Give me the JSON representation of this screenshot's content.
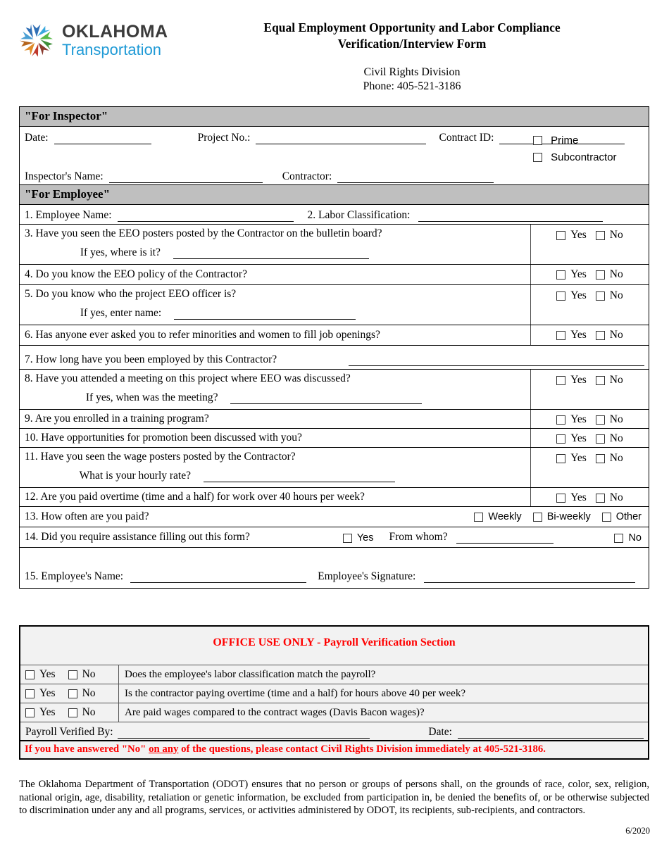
{
  "header": {
    "logo_name_line1": "OKLAHOMA",
    "logo_name_line2": "Transportation",
    "title_line1": "Equal Employment Opportunity and Labor Compliance",
    "title_line2": "Verification/Interview Form",
    "division": "Civil Rights Division",
    "phone": "Phone: 405-521-3186"
  },
  "inspector": {
    "band_label": "\"For Inspector\"",
    "date_label": "Date:",
    "project_no_label": "Project No.:",
    "contract_id_label": "Contract ID:",
    "inspector_name_label": "Inspector's Name:",
    "contractor_label": "Contractor:",
    "prime_label": "Prime",
    "subcontractor_label": "Subcontractor",
    "date_value": "",
    "project_no_value": "",
    "contract_id_value": "",
    "inspector_name_value": "",
    "contractor_value": ""
  },
  "employee": {
    "band_label": "\"For Employee\"",
    "q1_label": "1. Employee Name:",
    "q1_value": "",
    "q2_label": "2. Labor Classification:",
    "q2_value": "",
    "q3": "3. Have you seen the EEO posters posted by the Contractor on the bulletin board?",
    "q3_sub": "If yes, where is it?",
    "q3_sub_value": "",
    "q4": "4. Do you know the EEO policy of the Contractor?",
    "q5": "5. Do you know who the project EEO officer is?",
    "q5_sub": "If yes, enter name:",
    "q5_sub_value": "",
    "q6": "6. Has anyone ever asked you to refer minorities and women to fill job openings?",
    "q7": "7. How long have you been employed by this Contractor?",
    "q7_value": "",
    "q8": "8. Have you attended a meeting on this project where EEO was discussed?",
    "q8_sub": "If yes, when was the meeting?",
    "q8_sub_value": "",
    "q9": "9. Are you enrolled in a training program?",
    "q10": "10. Have opportunities for promotion been discussed with you?",
    "q11": "11. Have you seen the wage posters posted by the Contractor?",
    "q11_sub": "What is your hourly rate?",
    "q11_sub_value": "",
    "q12": "12. Are you paid overtime (time and a half) for work over 40 hours per week?",
    "q13": "13. How often are you paid?",
    "q13_opt1": "Weekly",
    "q13_opt2": "Bi-weekly",
    "q13_opt3": "Other",
    "q14": "14. Did you require assistance filling out this form?",
    "q14_from_whom": "From whom?",
    "q14_from_whom_value": "",
    "q15_name_label": "15. Employee's Name:",
    "q15_name_value": "",
    "q15_sig_label": "Employee's Signature:",
    "q15_sig_value": "",
    "yes_label": "Yes",
    "no_label": "No"
  },
  "office": {
    "title": "OFFICE USE ONLY - Payroll Verification Section",
    "yes_label": "Yes",
    "no_label": "No",
    "rows": [
      "Does the employee's labor classification match the payroll?",
      "Is the contractor paying overtime (time and a half) for hours above 40 per week?",
      "Are paid wages compared to the contract wages (Davis Bacon wages)?"
    ],
    "verified_by_label": "Payroll Verified By:",
    "verified_by_value": "",
    "date_label": "Date:",
    "date_value": "",
    "warning_pre": "If you have answered \"No\" ",
    "warning_underline": "on any",
    "warning_post": " of the questions, please contact Civil Rights Division immediately at 405-521-3186."
  },
  "footer": {
    "disclaimer": "The Oklahoma Department of Transportation (ODOT) ensures that no person or groups of persons shall, on the grounds of race, color, sex, religion, national origin, age, disability, retaliation or genetic information, be excluded from participation in, be denied the benefits of, or be otherwise subjected to discrimination under any and all programs, services, or activities administered by ODOT, its recipients, sub-recipients, and contractors.",
    "revision": "6/2020"
  },
  "colors": {
    "band_gray": "#bfbfbf",
    "office_bg": "#f2f2f2",
    "alert_red": "#ff0000",
    "logo_blue": "#1f9ad6"
  }
}
